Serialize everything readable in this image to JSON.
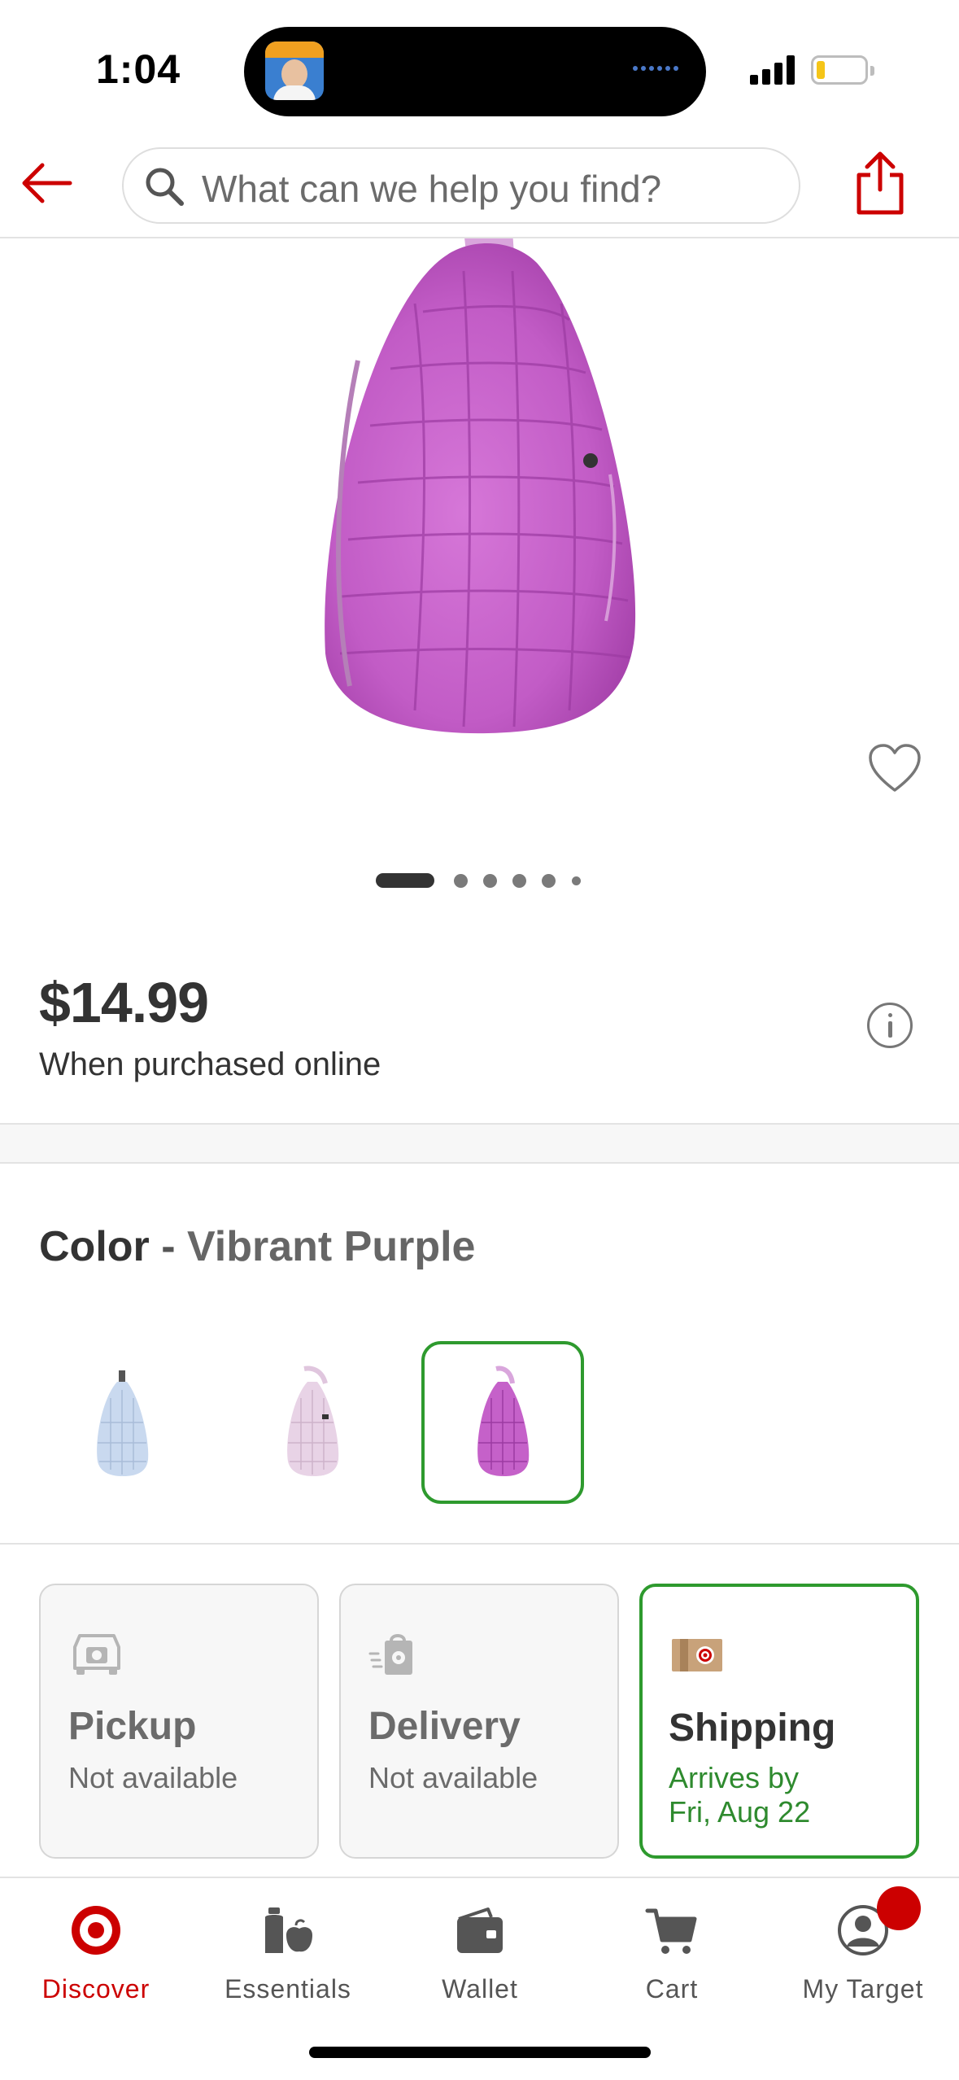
{
  "status_bar": {
    "time": "1:04"
  },
  "header": {
    "search_placeholder": "What can we help you find?",
    "accent_color": "#cc0000"
  },
  "product": {
    "carousel": {
      "total": 6,
      "current": 1
    },
    "price": "$14.99",
    "price_note": "When purchased online"
  },
  "color": {
    "label": "Color",
    "separator": "-",
    "selected": "Vibrant Purple",
    "swatches": [
      {
        "name": "light-blue",
        "hex": "#c9d9ef",
        "selected": false
      },
      {
        "name": "light-pink",
        "hex": "#e8d3e6",
        "selected": false
      },
      {
        "name": "vibrant-purple",
        "hex": "#c561c9",
        "selected": true
      }
    ],
    "selected_border_color": "#2e9a2e"
  },
  "fulfillment": [
    {
      "title": "Pickup",
      "status": "Not available",
      "icon": "car-pickup-icon",
      "selected": false
    },
    {
      "title": "Delivery",
      "status": "Not available",
      "icon": "delivery-bag-icon",
      "selected": false
    },
    {
      "title": "Shipping",
      "status_line1": "Arrives by",
      "status_line2": "Fri, Aug 22",
      "icon": "shipping-box-icon",
      "selected": true
    }
  ],
  "bottom_nav": [
    {
      "label": "Discover",
      "icon": "target-bullseye-icon",
      "active": true
    },
    {
      "label": "Essentials",
      "icon": "essentials-icon",
      "active": false
    },
    {
      "label": "Wallet",
      "icon": "wallet-icon",
      "active": false
    },
    {
      "label": "Cart",
      "icon": "cart-icon",
      "active": false
    },
    {
      "label": "My Target",
      "icon": "account-icon",
      "active": false,
      "has_notification": true
    }
  ]
}
